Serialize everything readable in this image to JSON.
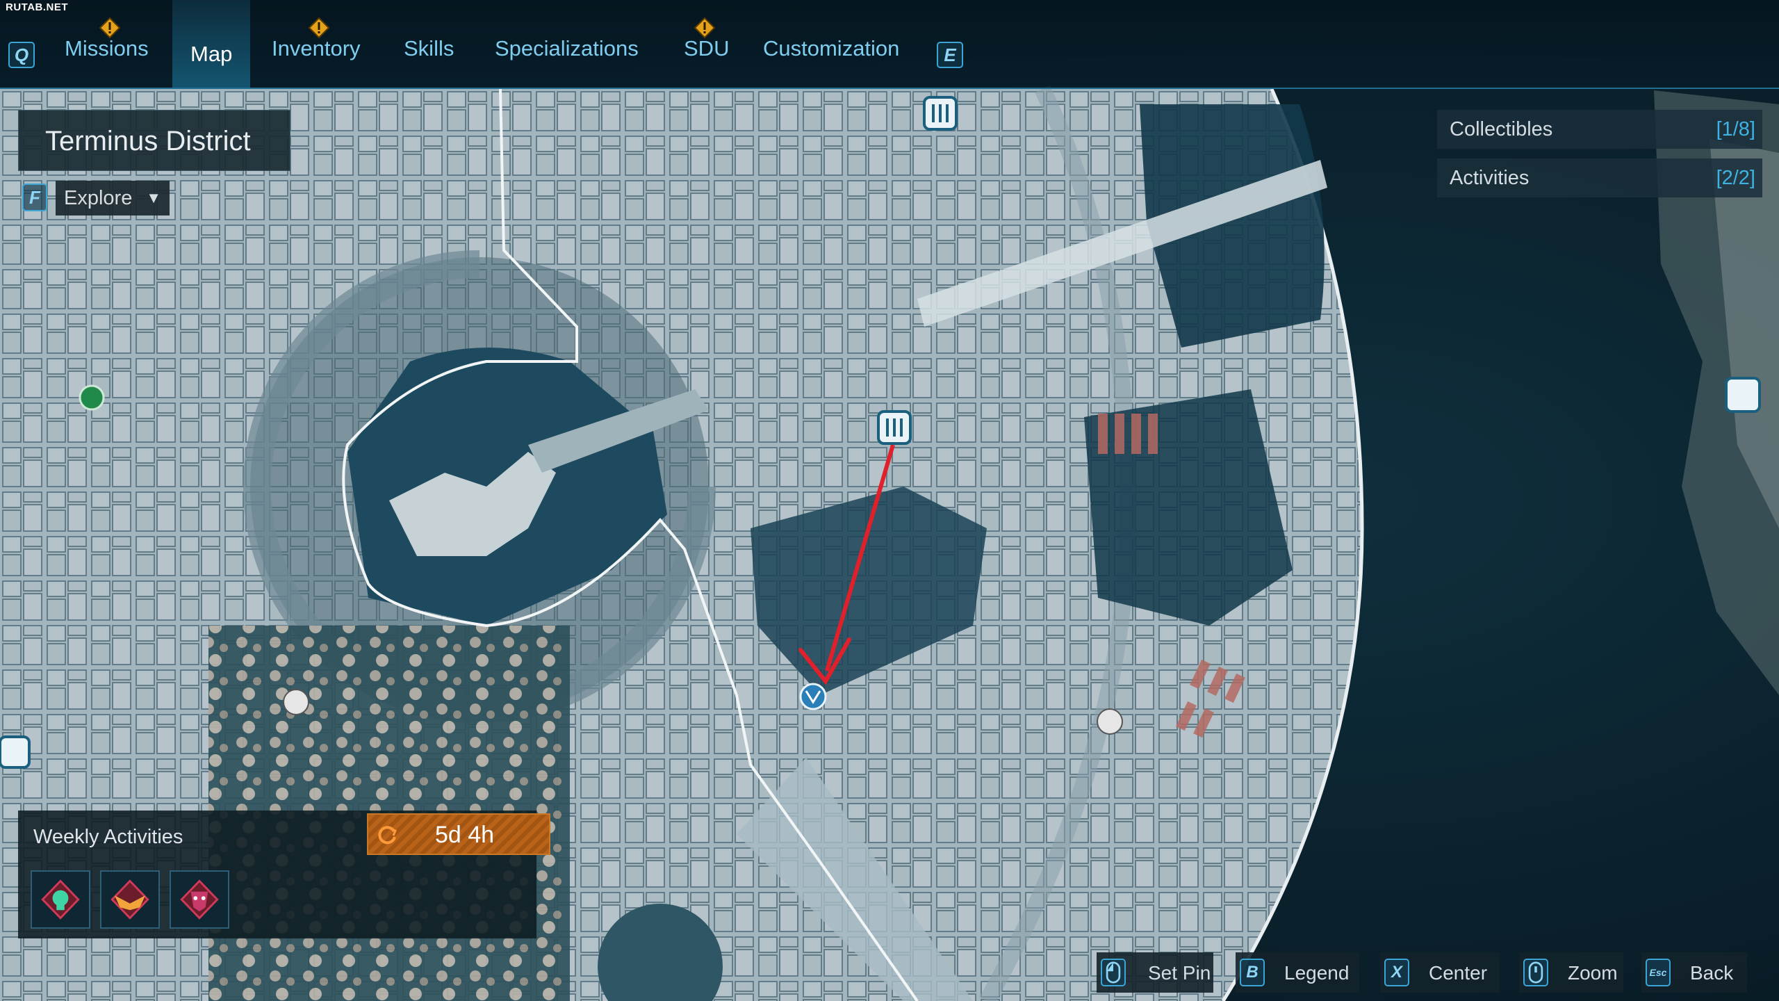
{
  "watermark": "RUTAB.NET",
  "nav": {
    "prev_key": "Q",
    "next_key": "E",
    "tabs": [
      {
        "label": "Missions",
        "alert": true
      },
      {
        "label": "Map",
        "active": true
      },
      {
        "label": "Inventory",
        "alert": true
      },
      {
        "label": "Skills"
      },
      {
        "label": "Specializations"
      },
      {
        "label": "SDU",
        "alert": true
      },
      {
        "label": "Customization"
      }
    ]
  },
  "location": {
    "district": "Terminus District",
    "explore_key": "F",
    "explore_label": "Explore"
  },
  "right_panels": {
    "collectibles": {
      "label": "Collectibles",
      "count": "[1/8]"
    },
    "activities": {
      "label": "Activities",
      "count": "[2/2]"
    }
  },
  "weekly": {
    "title": "Weekly Activities",
    "timer": "5d 4h",
    "activity_icons": [
      "skull-activity-icon",
      "winged-activity-icon",
      "mask-activity-icon"
    ]
  },
  "hints": [
    {
      "key": "",
      "label": "Set Pin",
      "icon": "mouse-left-icon"
    },
    {
      "key": "B",
      "label": "Legend"
    },
    {
      "key": "X",
      "label": "Center"
    },
    {
      "key": "",
      "label": "Zoom",
      "icon": "mouse-wheel-icon"
    },
    {
      "key": "Esc",
      "label": "Back"
    }
  ],
  "colors": {
    "accent": "#3fb2e4",
    "tab_text": "#7fcdef",
    "timer": "#b8621a",
    "annotation_arrow": "#e0202a",
    "water": "#1d4a5e",
    "land": "#b9c8cf"
  }
}
